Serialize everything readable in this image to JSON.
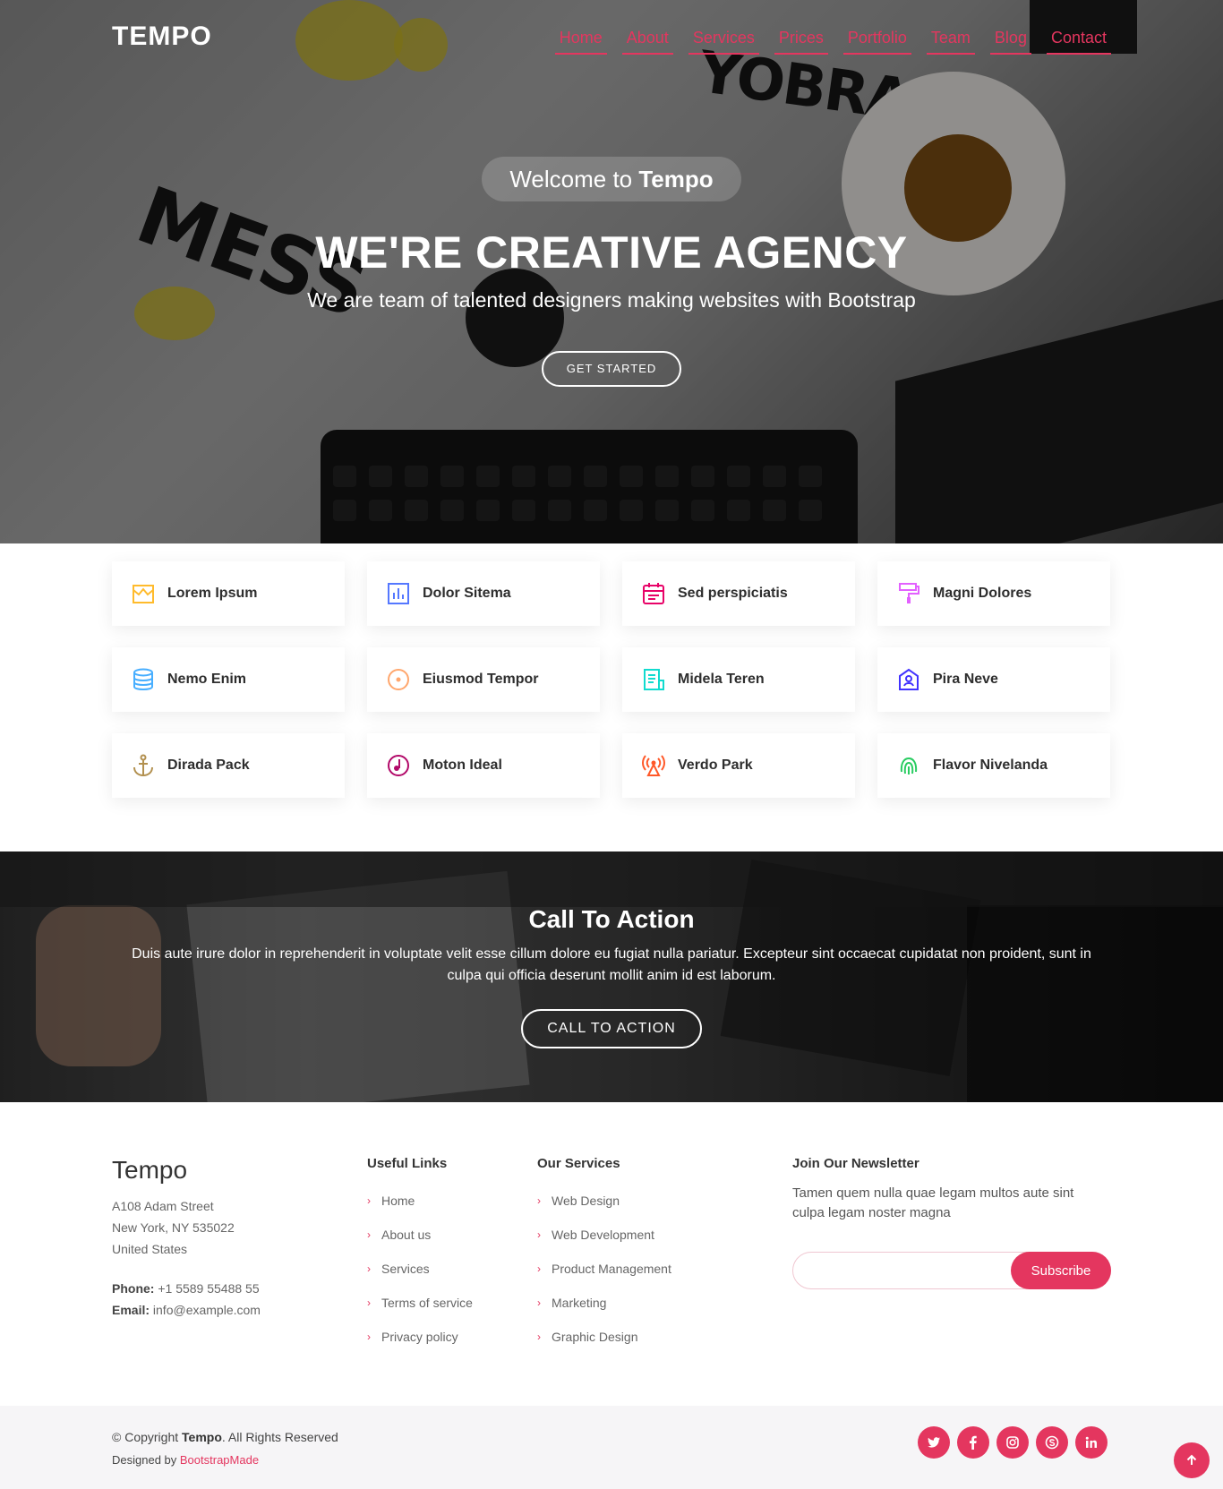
{
  "header": {
    "brand": "TEMPO",
    "nav": [
      "Home",
      "About",
      "Services",
      "Prices",
      "Portfolio",
      "Team",
      "Blog",
      "Contact"
    ]
  },
  "hero": {
    "welcome_prefix": "Welcome to ",
    "welcome_brand": "Tempo",
    "title": "WE'RE CREATIVE AGENCY",
    "subtitle": "We are team of talented designers making websites with Bootstrap",
    "cta": "GET STARTED"
  },
  "features": [
    {
      "label": "Lorem Ipsum",
      "icon": "store-icon",
      "color": "#ffbb2c"
    },
    {
      "label": "Dolor Sitema",
      "icon": "bar-chart-icon",
      "color": "#5578ff"
    },
    {
      "label": "Sed perspiciatis",
      "icon": "calendar-icon",
      "color": "#e80368"
    },
    {
      "label": "Magni Dolores",
      "icon": "paint-roller-icon",
      "color": "#e361ff"
    },
    {
      "label": "Nemo Enim",
      "icon": "database-icon",
      "color": "#47aeff"
    },
    {
      "label": "Eiusmod Tempor",
      "icon": "disc-icon",
      "color": "#ffa76e"
    },
    {
      "label": "Midela Teren",
      "icon": "document-icon",
      "color": "#11dbcf"
    },
    {
      "label": "Pira Neve",
      "icon": "id-badge-icon",
      "color": "#4233ff"
    },
    {
      "label": "Dirada Pack",
      "icon": "anchor-icon",
      "color": "#b2904f"
    },
    {
      "label": "Moton Ideal",
      "icon": "music-disc-icon",
      "color": "#b20969"
    },
    {
      "label": "Verdo Park",
      "icon": "broadcast-icon",
      "color": "#ff5828"
    },
    {
      "label": "Flavor Nivelanda",
      "icon": "fingerprint-icon",
      "color": "#29cc61"
    }
  ],
  "cta": {
    "title": "Call To Action",
    "text": "Duis aute irure dolor in reprehenderit in voluptate velit esse cillum dolore eu fugiat nulla pariatur. Excepteur sint occaecat cupidatat non proident, sunt in culpa qui officia deserunt mollit anim id est laborum.",
    "button": "CALL TO ACTION"
  },
  "footer": {
    "brand": "Tempo",
    "address": [
      "A108 Adam Street",
      "New York, NY 535022",
      "United States"
    ],
    "phone_label": "Phone:",
    "phone": " +1 5589 55488 55",
    "email_label": "Email:",
    "email": " info@example.com",
    "useful_links_title": "Useful Links",
    "useful_links": [
      "Home",
      "About us",
      "Services",
      "Terms of service",
      "Privacy policy"
    ],
    "services_title": "Our Services",
    "services": [
      "Web Design",
      "Web Development",
      "Product Management",
      "Marketing",
      "Graphic Design"
    ],
    "newsletter_title": "Join Our Newsletter",
    "newsletter_text": "Tamen quem nulla quae legam multos aute sint culpa legam noster magna",
    "newsletter_value": "",
    "subscribe": "Subscribe",
    "copyright_prefix": "© Copyright ",
    "copyright_brand": "Tempo",
    "copyright_suffix": ". All Rights Reserved",
    "designed_by": "Designed by ",
    "designer": "BootstrapMade",
    "socials": [
      "twitter-icon",
      "facebook-icon",
      "instagram-icon",
      "skype-icon",
      "linkedin-icon"
    ]
  },
  "colors": {
    "accent": "#e4365f"
  }
}
